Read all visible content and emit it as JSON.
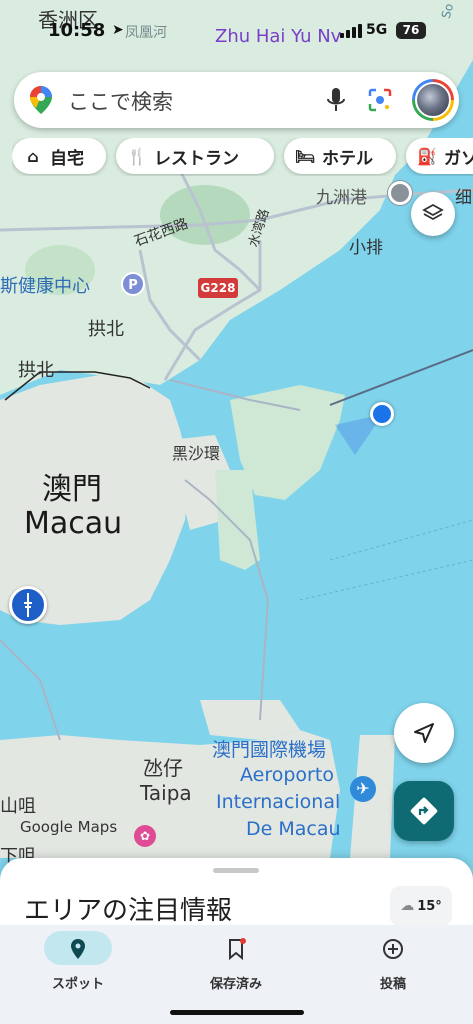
{
  "status_bar": {
    "time": "10:58",
    "network": "5G",
    "battery": "76"
  },
  "search": {
    "placeholder": "ここで検索"
  },
  "chips": [
    {
      "icon": "home-icon",
      "label": "自宅"
    },
    {
      "icon": "restaurant-icon",
      "label": "レストラン"
    },
    {
      "icon": "hotel-icon",
      "label": "ホテル"
    },
    {
      "icon": "gas-station-icon",
      "label": "ガソ"
    }
  ],
  "map_labels": {
    "xiangzhou": "香洲区",
    "fenghuanghe": "凤凰河",
    "zhuhai_yu_nv": "Zhu Hai Yu Nv",
    "jiuzhou_port": "九洲港",
    "xiaopai": "小排",
    "shihua_xilu": "石花西路",
    "shuiwan_lu": "水湾路",
    "health_center": "斯健康中心",
    "road_g228": "G228",
    "gongbei_1": "拱北",
    "gongbei_2": "拱北",
    "heisha_huan": "黑沙環",
    "macau_cn": "澳門",
    "macau_en": "Macau",
    "taipa_cn": "氹仔",
    "taipa_en": "Taipa",
    "airport_cn": "澳門國際機場",
    "airport_pt_1": "Aeroporto",
    "airport_pt_2": "Internacional",
    "airport_pt_3": "De Macau",
    "shanju": "山咀",
    "xiaju": "下咀",
    "google_maps": "Google Maps",
    "partial_right": "细",
    "partial_top_right": "So"
  },
  "bottom_sheet": {
    "title": "エリアの注目情報",
    "temperature": "15°"
  },
  "nav": [
    {
      "label": "スポット",
      "icon": "pin-icon",
      "active": true
    },
    {
      "label": "保存済み",
      "icon": "bookmark-icon",
      "active": false
    },
    {
      "label": "投稿",
      "icon": "add-circle-icon",
      "active": false
    }
  ],
  "colors": {
    "water": "#7fd3eb",
    "land": "#d9ecdf",
    "accent": "#0f6b73",
    "location_blue": "#1a73e8"
  }
}
